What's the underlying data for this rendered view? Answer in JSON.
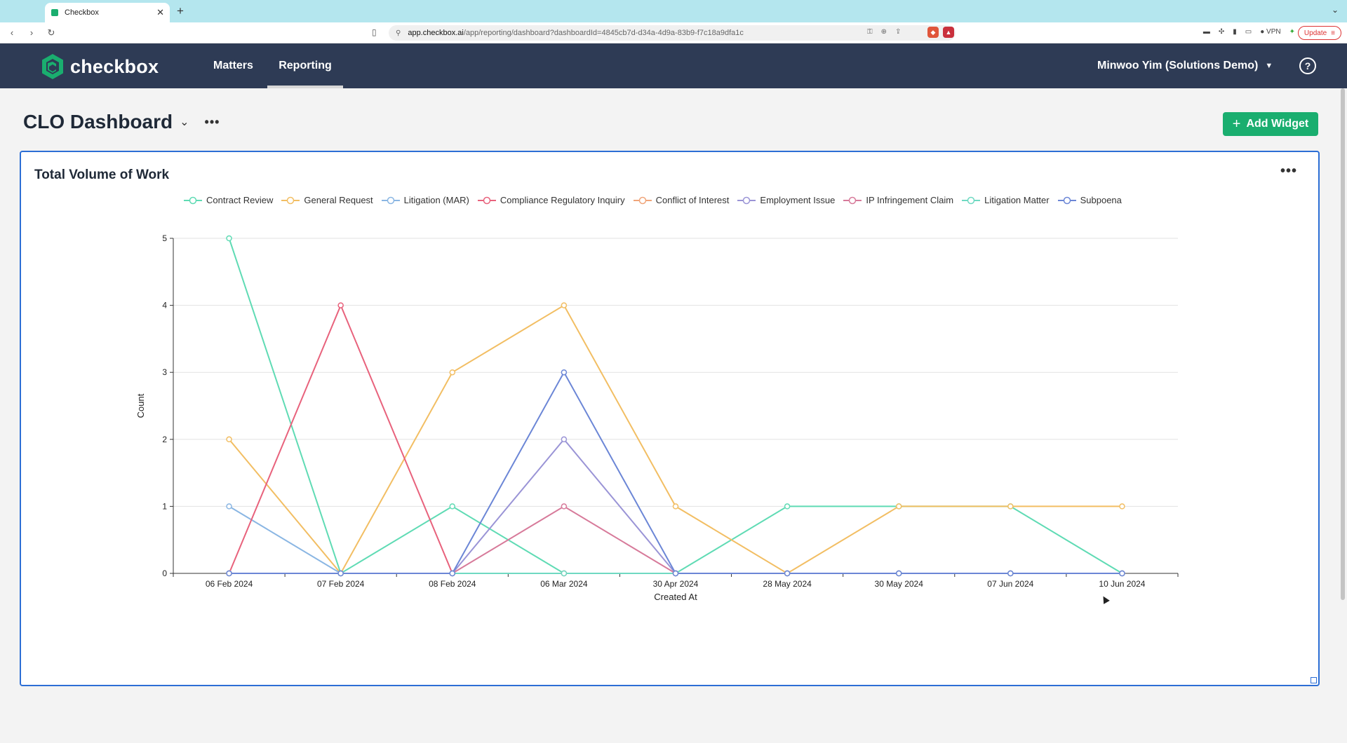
{
  "browser": {
    "tab_title": "Checkbox",
    "url_host": "app.checkbox.ai",
    "url_path": "/app/reporting/dashboard?dashboardId=4845cb7d-d34a-4d9a-83b9-f7c18a9dfa1c",
    "vpn_label": "VPN",
    "update_label": "Update"
  },
  "header": {
    "logo_text": "checkbox",
    "nav": {
      "matters": "Matters",
      "reporting": "Reporting"
    },
    "user": "Minwoo Yim (Solutions Demo)"
  },
  "dashboard": {
    "title": "CLO Dashboard",
    "add_widget_label": "Add Widget"
  },
  "widget": {
    "title": "Total Volume of Work"
  },
  "colors": {
    "accent_green": "#1aae6f",
    "header_bg": "#2e3b55",
    "widget_border": "#2c6ed5"
  },
  "chart_data": {
    "type": "line",
    "title": "Total Volume of Work",
    "xlabel": "Created At",
    "ylabel": "Count",
    "ylim": [
      0,
      5
    ],
    "yticks": [
      0,
      1,
      2,
      3,
      4,
      5
    ],
    "grid": true,
    "legend_position": "top",
    "categories": [
      "06 Feb 2024",
      "07 Feb 2024",
      "08 Feb 2024",
      "06 Mar 2024",
      "30 Apr 2024",
      "28 May 2024",
      "30 May 2024",
      "07 Jun 2024",
      "10 Jun 2024"
    ],
    "series": [
      {
        "name": "Contract Review",
        "color": "#5fdbb4",
        "values": [
          5,
          0,
          1,
          0,
          0,
          1,
          1,
          1,
          0
        ]
      },
      {
        "name": "General Request",
        "color": "#f2be63",
        "values": [
          2,
          0,
          3,
          4,
          1,
          0,
          1,
          1,
          1
        ]
      },
      {
        "name": "Litigation (MAR)",
        "color": "#8ab6e3",
        "values": [
          1,
          0,
          0,
          0,
          0,
          0,
          0,
          0,
          0
        ]
      },
      {
        "name": "Compliance Regulatory Inquiry",
        "color": "#e8627c",
        "values": [
          0,
          4,
          0,
          0,
          0,
          0,
          0,
          0,
          0
        ]
      },
      {
        "name": "Conflict of Interest",
        "color": "#f0a57a",
        "values": [
          0,
          0,
          0,
          0,
          0,
          0,
          0,
          0,
          0
        ]
      },
      {
        "name": "Employment Issue",
        "color": "#9a94d6",
        "values": [
          0,
          0,
          0,
          2,
          0,
          0,
          0,
          0,
          0
        ]
      },
      {
        "name": "IP Infringement Claim",
        "color": "#d77a9a",
        "values": [
          0,
          0,
          0,
          1,
          0,
          0,
          0,
          0,
          0
        ]
      },
      {
        "name": "Litigation Matter",
        "color": "#6fd9c2",
        "values": [
          0,
          0,
          0,
          0,
          0,
          0,
          0,
          0,
          0
        ]
      },
      {
        "name": "Subpoena",
        "color": "#6b86d6",
        "values": [
          0,
          0,
          0,
          3,
          0,
          0,
          0,
          0,
          0
        ]
      }
    ]
  }
}
